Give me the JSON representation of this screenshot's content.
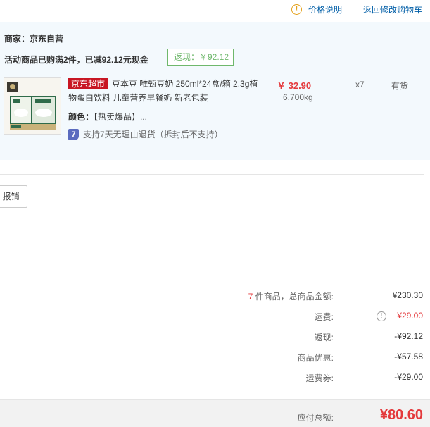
{
  "header": {
    "price_info_icon": "exclamation-circle-icon",
    "price_info_label": "价格说明",
    "back_to_cart_label": "返回修改购物车"
  },
  "shop": {
    "merchant_label": "商家：京东自营",
    "promo_text": "活动商品已购满2件，已减92.12元现金",
    "rebate_text": "返现：￥92.12"
  },
  "product": {
    "badge": "京东超市",
    "title": "豆本豆 唯甄豆奶 250ml*24盒/箱 2.3g植物蛋白饮料 儿童营养早餐奶 新老包装",
    "price": "￥ 32.90",
    "weight": "6.700kg",
    "quantity": "x7",
    "stock": "有货",
    "color_label": "颜色：",
    "color_value": "【热卖爆品】...",
    "return_badge": "7",
    "return_text": "支持7天无理由退货（拆封后不支持）"
  },
  "report_button": "报销",
  "summary": {
    "item_count": "7",
    "item_count_suffix": " 件商品，总商品金额:",
    "item_total": "¥230.30",
    "shipping_label": "运费:",
    "shipping_value": "¥29.00",
    "rebate_label": "返现:",
    "rebate_value": "-¥92.12",
    "discount_label": "商品优惠:",
    "discount_value": "-¥57.58",
    "coupon_label": "运费券:",
    "coupon_value": "-¥29.00",
    "total_label": "应付总额:",
    "total_value": "¥80.60"
  },
  "colors": {
    "accent_red": "#e4393c",
    "link_blue": "#005ea7",
    "rebate_green": "#6fb86c",
    "shop_bg": "#f3f9fd"
  }
}
